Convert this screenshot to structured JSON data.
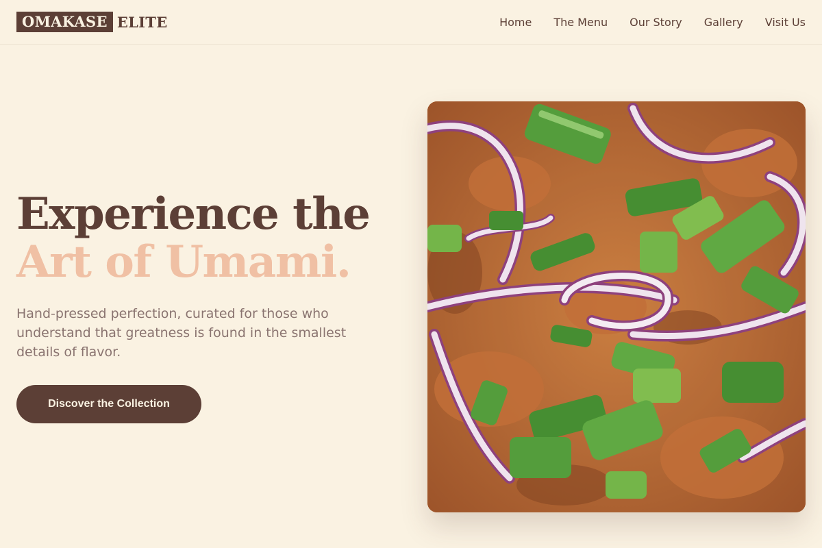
{
  "brand": {
    "logo_box_text": "OMAKASE",
    "logo_rest_text": "ELITE"
  },
  "nav": {
    "items": [
      "Home",
      "The Menu",
      "Our Story",
      "Gallery",
      "Visit Us"
    ]
  },
  "hero": {
    "headline_line1": "Experience the",
    "headline_line2": "Art of Umami.",
    "subtext": "Hand-pressed perfection, curated for those who understand that greatness is found in the smallest details of flavor.",
    "cta_label": "Discover the Collection"
  },
  "colors": {
    "background": "#faf2e2",
    "primary": "#5c3f36",
    "accent": "#f0c0a4",
    "body_text": "#8a7470"
  }
}
